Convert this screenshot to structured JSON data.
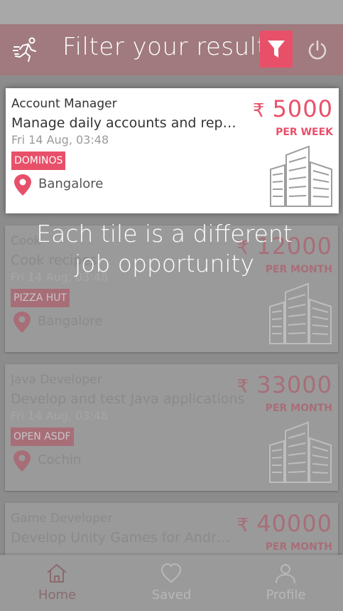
{
  "header": {
    "title": "Filter your results",
    "icons": [
      "runner-icon",
      "filter-icon",
      "power-icon"
    ]
  },
  "jobs": [
    {
      "title": "Account Manager",
      "description": "Manage daily accounts and report",
      "date": "Fri 14 Aug, 03:48",
      "company": "DOMINOS",
      "location": "Bangalore",
      "currency": "₹",
      "salary": "5000",
      "period": "PER WEEK"
    },
    {
      "title": "Cook",
      "description": "Cook recipes",
      "date": "Fri 14 Aug, 03:48",
      "company": "PIZZA HUT",
      "location": "Bangalore",
      "currency": "₹",
      "salary": "12000",
      "period": "PER MONTH"
    },
    {
      "title": "Java Developer",
      "description": "Develop and test Java applications",
      "date": "Fri 14 Aug, 03:48",
      "company": "OPEN ASDF",
      "location": "Cochin",
      "currency": "₹",
      "salary": "33000",
      "period": "PER MONTH"
    },
    {
      "title": "Game Developer",
      "description": "Develop Unity Games for Androi...",
      "currency": "₹",
      "salary": "40000",
      "period": "PER MONTH"
    }
  ],
  "overlay": {
    "line1": "Each tile is a different",
    "line2": "job opportunity"
  },
  "nav": {
    "home": "Home",
    "saved": "Saved",
    "profile": "Profile"
  },
  "colors": {
    "accent": "#e8506a",
    "header_dim": "#a07a7e"
  }
}
